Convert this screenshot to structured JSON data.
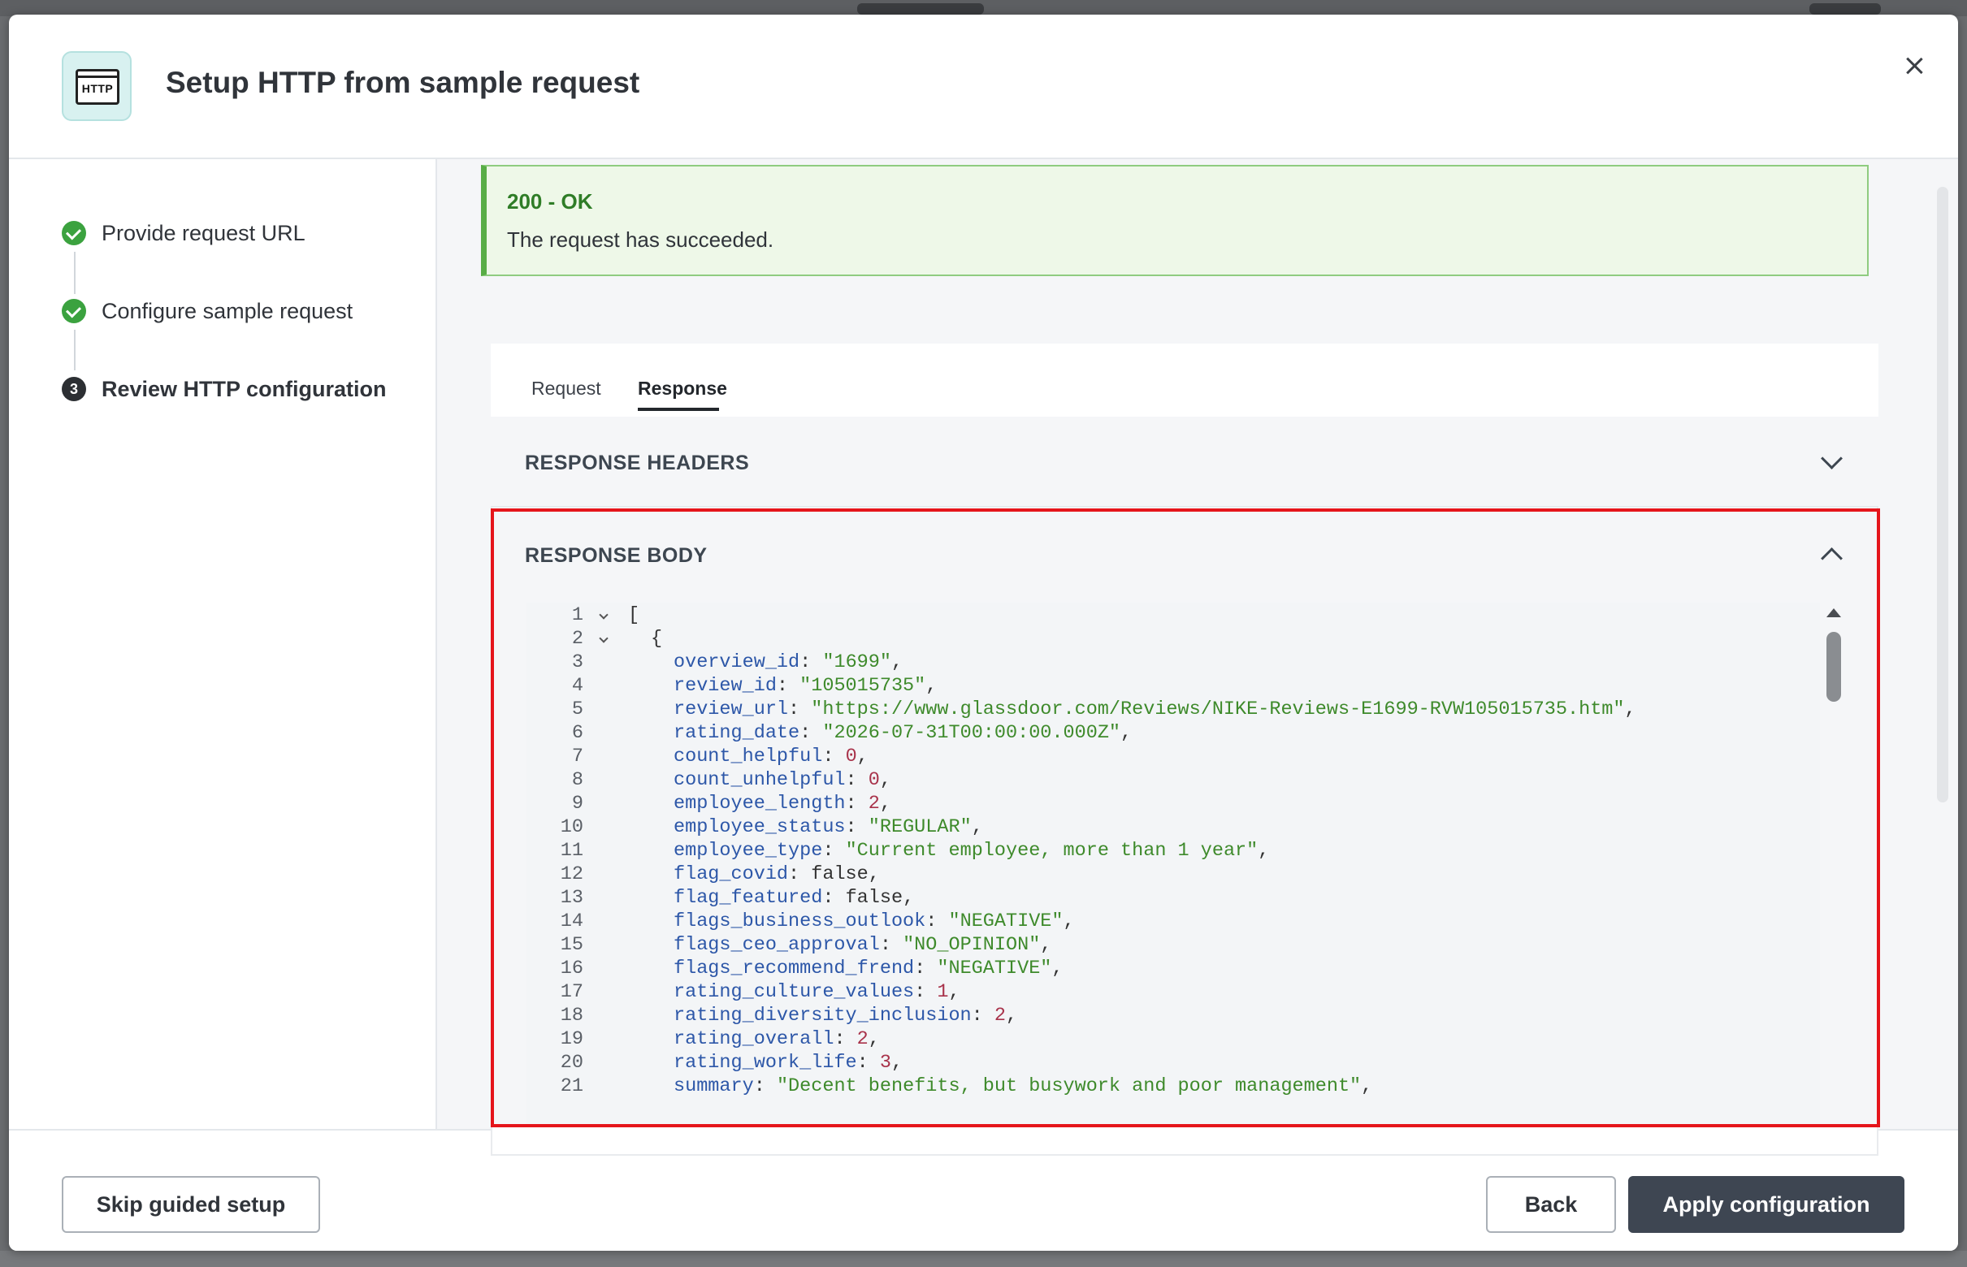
{
  "dialog": {
    "title": "Setup HTTP from sample request",
    "icon_label": "HTTP",
    "icon": "http-window-icon"
  },
  "steps": [
    {
      "label": "Provide request URL",
      "status": "done"
    },
    {
      "label": "Configure sample request",
      "status": "done"
    },
    {
      "label": "Review HTTP configuration",
      "status": "current",
      "number": "3"
    }
  ],
  "alert": {
    "title": "200 - OK",
    "message": "The request has succeeded."
  },
  "tabs": [
    {
      "label": "Request",
      "active": false
    },
    {
      "label": "Response",
      "active": true
    }
  ],
  "sections": {
    "headers_title": "RESPONSE HEADERS",
    "body_title": "RESPONSE BODY"
  },
  "code_lines": [
    {
      "n": "1",
      "fold": true,
      "parts": [
        [
          "p",
          "["
        ]
      ],
      "indent": 0
    },
    {
      "n": "2",
      "fold": true,
      "parts": [
        [
          "p",
          "{"
        ]
      ],
      "indent": 1
    },
    {
      "n": "3",
      "parts": [
        [
          "k",
          "overview_id"
        ],
        [
          "p",
          ": "
        ],
        [
          "s",
          "\"1699\""
        ],
        [
          "p",
          ","
        ]
      ],
      "indent": 2
    },
    {
      "n": "4",
      "parts": [
        [
          "k",
          "review_id"
        ],
        [
          "p",
          ": "
        ],
        [
          "s",
          "\"105015735\""
        ],
        [
          "p",
          ","
        ]
      ],
      "indent": 2
    },
    {
      "n": "5",
      "parts": [
        [
          "k",
          "review_url"
        ],
        [
          "p",
          ": "
        ],
        [
          "s",
          "\"https://www.glassdoor.com/Reviews/NIKE-Reviews-E1699-RVW105015735.htm\""
        ],
        [
          "p",
          ","
        ]
      ],
      "indent": 2
    },
    {
      "n": "6",
      "parts": [
        [
          "k",
          "rating_date"
        ],
        [
          "p",
          ": "
        ],
        [
          "s",
          "\"2026-07-31T00:00:00.000Z\""
        ],
        [
          "p",
          ","
        ]
      ],
      "indent": 2
    },
    {
      "n": "7",
      "parts": [
        [
          "k",
          "count_helpful"
        ],
        [
          "p",
          ": "
        ],
        [
          "n",
          "0"
        ],
        [
          "p",
          ","
        ]
      ],
      "indent": 2
    },
    {
      "n": "8",
      "parts": [
        [
          "k",
          "count_unhelpful"
        ],
        [
          "p",
          ": "
        ],
        [
          "n",
          "0"
        ],
        [
          "p",
          ","
        ]
      ],
      "indent": 2
    },
    {
      "n": "9",
      "parts": [
        [
          "k",
          "employee_length"
        ],
        [
          "p",
          ": "
        ],
        [
          "n",
          "2"
        ],
        [
          "p",
          ","
        ]
      ],
      "indent": 2
    },
    {
      "n": "10",
      "parts": [
        [
          "k",
          "employee_status"
        ],
        [
          "p",
          ": "
        ],
        [
          "s",
          "\"REGULAR\""
        ],
        [
          "p",
          ","
        ]
      ],
      "indent": 2
    },
    {
      "n": "11",
      "parts": [
        [
          "k",
          "employee_type"
        ],
        [
          "p",
          ": "
        ],
        [
          "s",
          "\"Current employee, more than 1 year\""
        ],
        [
          "p",
          ","
        ]
      ],
      "indent": 2
    },
    {
      "n": "12",
      "parts": [
        [
          "k",
          "flag_covid"
        ],
        [
          "p",
          ": "
        ],
        [
          "b",
          "false"
        ],
        [
          "p",
          ","
        ]
      ],
      "indent": 2
    },
    {
      "n": "13",
      "parts": [
        [
          "k",
          "flag_featured"
        ],
        [
          "p",
          ": "
        ],
        [
          "b",
          "false"
        ],
        [
          "p",
          ","
        ]
      ],
      "indent": 2
    },
    {
      "n": "14",
      "parts": [
        [
          "k",
          "flags_business_outlook"
        ],
        [
          "p",
          ": "
        ],
        [
          "s",
          "\"NEGATIVE\""
        ],
        [
          "p",
          ","
        ]
      ],
      "indent": 2
    },
    {
      "n": "15",
      "parts": [
        [
          "k",
          "flags_ceo_approval"
        ],
        [
          "p",
          ": "
        ],
        [
          "s",
          "\"NO_OPINION\""
        ],
        [
          "p",
          ","
        ]
      ],
      "indent": 2
    },
    {
      "n": "16",
      "parts": [
        [
          "k",
          "flags_recommend_frend"
        ],
        [
          "p",
          ": "
        ],
        [
          "s",
          "\"NEGATIVE\""
        ],
        [
          "p",
          ","
        ]
      ],
      "indent": 2
    },
    {
      "n": "17",
      "parts": [
        [
          "k",
          "rating_culture_values"
        ],
        [
          "p",
          ": "
        ],
        [
          "n",
          "1"
        ],
        [
          "p",
          ","
        ]
      ],
      "indent": 2
    },
    {
      "n": "18",
      "parts": [
        [
          "k",
          "rating_diversity_inclusion"
        ],
        [
          "p",
          ": "
        ],
        [
          "n",
          "2"
        ],
        [
          "p",
          ","
        ]
      ],
      "indent": 2
    },
    {
      "n": "19",
      "parts": [
        [
          "k",
          "rating_overall"
        ],
        [
          "p",
          ": "
        ],
        [
          "n",
          "2"
        ],
        [
          "p",
          ","
        ]
      ],
      "indent": 2
    },
    {
      "n": "20",
      "parts": [
        [
          "k",
          "rating_work_life"
        ],
        [
          "p",
          ": "
        ],
        [
          "n",
          "3"
        ],
        [
          "p",
          ","
        ]
      ],
      "indent": 2
    },
    {
      "n": "21",
      "parts": [
        [
          "k",
          "summary"
        ],
        [
          "p",
          ": "
        ],
        [
          "s",
          "\"Decent benefits, but busywork and poor management\""
        ],
        [
          "p",
          ","
        ]
      ],
      "indent": 2
    }
  ],
  "footer": {
    "skip_label": "Skip guided setup",
    "back_label": "Back",
    "apply_label": "Apply configuration"
  },
  "colors": {
    "success": "#3ba23f",
    "alert_bg": "#eef8e8",
    "highlight": "#e5151b",
    "primary_button": "#3e4652"
  }
}
